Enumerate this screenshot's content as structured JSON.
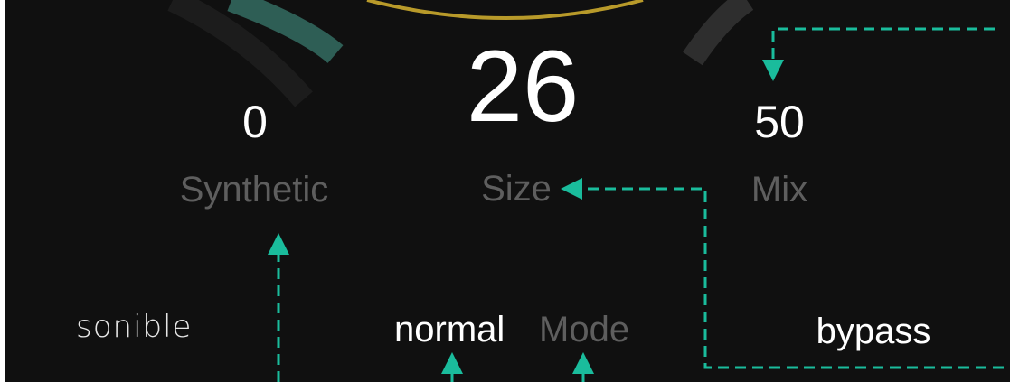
{
  "plugin": {
    "brand": "sonible",
    "colors": {
      "background": "#101010",
      "value_text": "#ffffff",
      "label_text": "#5e5e5e",
      "annotation": "#1abc9c",
      "knob_ring": "#2a2a2a",
      "accent_teal": "#2e5e55",
      "accent_gold": "#b89a2a"
    }
  },
  "controls": {
    "synthetic": {
      "value": "0",
      "label": "Synthetic"
    },
    "size": {
      "value": "26",
      "label": "Size"
    },
    "mix": {
      "value": "50",
      "label": "Mix"
    }
  },
  "footer": {
    "logo": "sonible",
    "mode_value": "normal",
    "mode_label": "Mode",
    "bypass_label": "bypass"
  },
  "annotations": {
    "icon": "dashed-arrow-icon",
    "count": 5
  }
}
